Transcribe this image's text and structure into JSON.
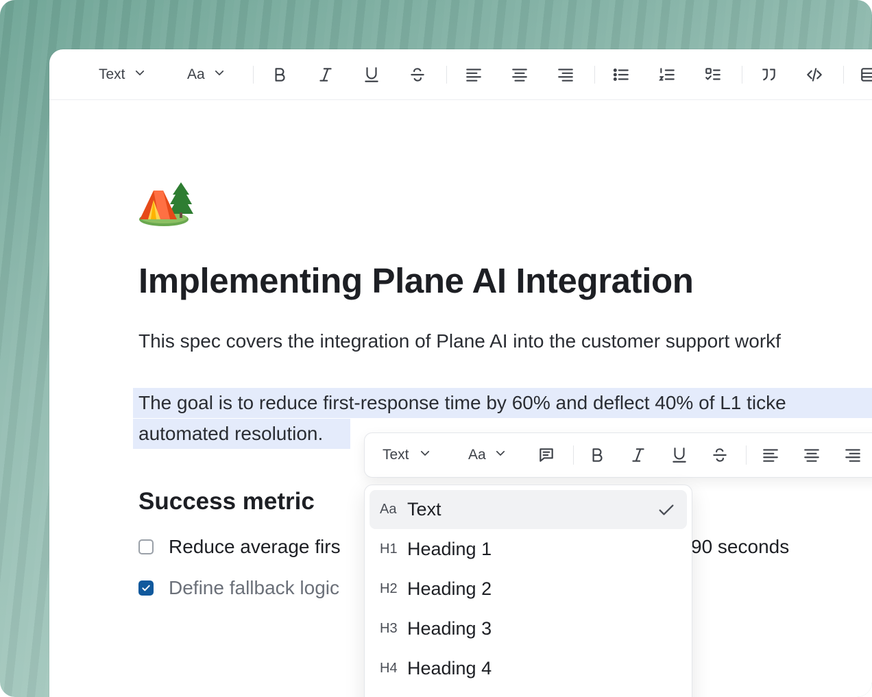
{
  "toolbar": {
    "text_dropdown": "Text",
    "font_dropdown": "Aa"
  },
  "document": {
    "title": "Implementing Plane AI Integration",
    "intro": "This spec covers the integration of Plane AI into the customer support workf",
    "goal_line1": "The goal is to reduce first-response time by 60% and deflect 40% of L1 ticke",
    "goal_line2": "automated resolution.",
    "section_heading": "Success metric",
    "tasks": [
      {
        "text": "Reduce average firs",
        "tail": "90 seconds",
        "checked": false
      },
      {
        "text": "Define fallback logic",
        "checked": true
      }
    ]
  },
  "bubble_menu": {
    "text_dropdown": "Text",
    "font_dropdown": "Aa"
  },
  "block_menu": {
    "items": [
      {
        "icon": "Aa",
        "label": "Text",
        "selected": true
      },
      {
        "icon": "H1",
        "label": "Heading 1"
      },
      {
        "icon": "H2",
        "label": "Heading 2"
      },
      {
        "icon": "H3",
        "label": "Heading 3"
      },
      {
        "icon": "H4",
        "label": "Heading 4"
      }
    ]
  },
  "colors": {
    "selection": "#e4ebfb",
    "checkbox_checked": "#10599d",
    "background_accent": "#8fb8ad"
  }
}
